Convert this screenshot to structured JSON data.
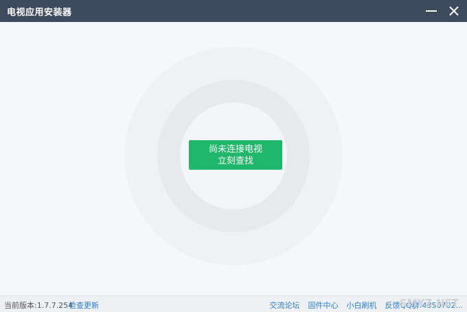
{
  "window": {
    "title": "电视应用安装器"
  },
  "main": {
    "connect_line1": "尚未连接电视",
    "connect_line2": "立刻查找"
  },
  "status": {
    "version_label": "当前版本:",
    "version": "1.7.7.254",
    "check_update": "检查更新",
    "links": [
      "交流论坛",
      "固件中心",
      "小白刷机",
      "反馈QQ群:4350702..."
    ]
  },
  "watermark": "SMYZ.NET",
  "colors": {
    "titlebar": "#3d4a5e",
    "accent": "#1fb86a",
    "link": "#2b7fd0"
  }
}
